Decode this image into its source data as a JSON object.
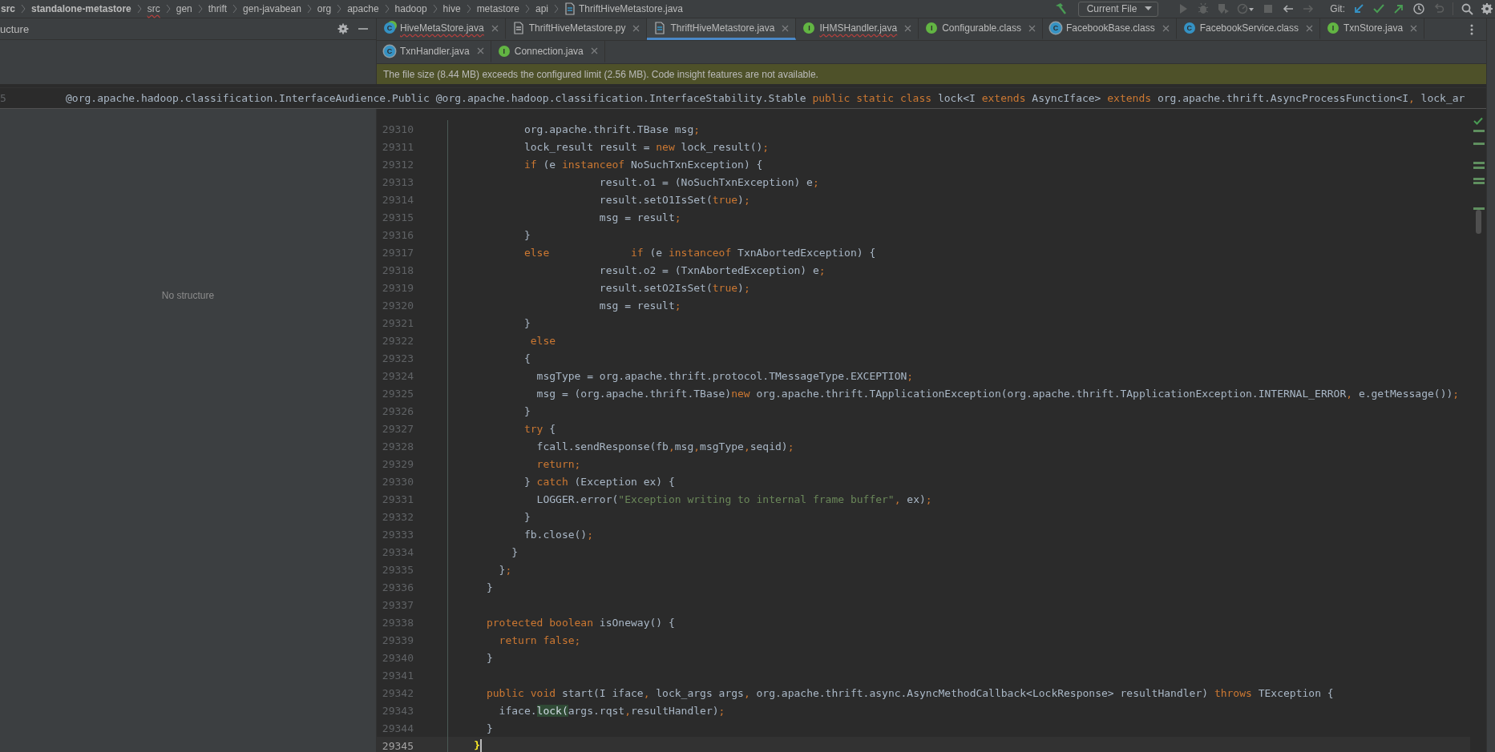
{
  "breadcrumbs": [
    {
      "label": "src",
      "bold": true,
      "error": false
    },
    {
      "label": "standalone-metastore",
      "bold": true,
      "error": false
    },
    {
      "label": "src",
      "bold": false,
      "error": true
    },
    {
      "label": "gen",
      "bold": false,
      "error": false
    },
    {
      "label": "thrift",
      "bold": false,
      "error": false
    },
    {
      "label": "gen-javabean",
      "bold": false,
      "error": false
    },
    {
      "label": "org",
      "bold": false,
      "error": false
    },
    {
      "label": "apache",
      "bold": false,
      "error": false
    },
    {
      "label": "hadoop",
      "bold": false,
      "error": false
    },
    {
      "label": "hive",
      "bold": false,
      "error": false
    },
    {
      "label": "metastore",
      "bold": false,
      "error": false
    },
    {
      "label": "api",
      "bold": false,
      "error": false
    },
    {
      "label": "ThriftHiveMetastore.java",
      "bold": false,
      "error": false,
      "kind": "file"
    }
  ],
  "toolbar": [
    {
      "kind": "hammer",
      "disabled": false
    },
    {
      "kind": "config",
      "label": "Current File"
    },
    {
      "kind": "run",
      "disabled": true
    },
    {
      "kind": "debug",
      "disabled": true
    },
    {
      "kind": "coverage",
      "disabled": true
    },
    {
      "kind": "profile",
      "disabled": true
    },
    {
      "kind": "stop",
      "disabled": true
    },
    {
      "kind": "back",
      "disabled": false
    },
    {
      "kind": "forward",
      "disabled": true
    },
    {
      "kind": "label",
      "label": "Git:"
    },
    {
      "kind": "update",
      "disabled": false
    },
    {
      "kind": "commit",
      "disabled": false
    },
    {
      "kind": "push",
      "disabled": false
    },
    {
      "kind": "history",
      "disabled": false
    },
    {
      "kind": "rollback",
      "disabled": true
    },
    {
      "kind": "search",
      "disabled": false
    },
    {
      "kind": "settings",
      "disabled": false
    }
  ],
  "structure_panel": {
    "title": "ucture",
    "empty_text": "No structure"
  },
  "tab_rows": [
    [
      {
        "label": "HiveMetaStore.java",
        "kind": "runnable-class",
        "badge": "C",
        "selected": false,
        "error": true
      },
      {
        "label": "ThriftHiveMetastore.py",
        "kind": "file",
        "selected": false,
        "error": false
      },
      {
        "label": "ThriftHiveMetastore.java",
        "kind": "java-file",
        "selected": true,
        "error": false
      },
      {
        "label": "IHMSHandler.java",
        "kind": "interface",
        "badge": "I",
        "selected": false,
        "error": true
      },
      {
        "label": "Configurable.class",
        "kind": "interface",
        "badge": "I",
        "selected": false,
        "error": false
      },
      {
        "label": "FacebookBase.class",
        "kind": "abstract-class",
        "badge": "C",
        "selected": false,
        "error": false
      },
      {
        "label": "FacebookService.class",
        "kind": "class",
        "badge": "C",
        "selected": false,
        "error": false
      },
      {
        "label": "TxnStore.java",
        "kind": "interface",
        "badge": "I",
        "selected": false,
        "error": false
      }
    ],
    [
      {
        "label": "TxnHandler.java",
        "kind": "abstract-class",
        "badge": "C",
        "selected": false,
        "error": false
      },
      {
        "label": "Connection.java",
        "kind": "interface",
        "badge": "I",
        "selected": false,
        "error": false
      }
    ]
  ],
  "banner": "The file size (8.44 MB) exceeds the configured limit (2.56 MB). Code insight features are not available.",
  "sticky_line": {
    "number": "5",
    "tokens": [
      {
        "kind": "plain",
        "text": "@org.apache.hadoop.classification.InterfaceAudience.Public @org.apache.hadoop.classification.InterfaceStability.Stable "
      },
      {
        "kind": "keyword",
        "text": "public static class"
      },
      {
        "kind": "plain",
        "text": " lock<I "
      },
      {
        "kind": "keyword",
        "text": "extends"
      },
      {
        "kind": "plain",
        "text": " AsyncIface> "
      },
      {
        "kind": "keyword",
        "text": "extends"
      },
      {
        "kind": "plain",
        "text": " org.apache.thrift.AsyncProcessFunction<I"
      },
      {
        "kind": "punct",
        "text": ","
      },
      {
        "kind": "plain",
        "text": " lock_ar"
      }
    ]
  },
  "code_lines": [
    {
      "number": "29310",
      "current": false,
      "tokens": [
        {
          "kind": "plain",
          "text": "            org.apache.thrift.TBase msg"
        },
        {
          "kind": "punct",
          "text": ";"
        }
      ]
    },
    {
      "number": "29311",
      "current": false,
      "tokens": [
        {
          "kind": "plain",
          "text": "            lock_result result = "
        },
        {
          "kind": "keyword",
          "text": "new"
        },
        {
          "kind": "plain",
          "text": " lock_result()"
        },
        {
          "kind": "punct",
          "text": ";"
        }
      ]
    },
    {
      "number": "29312",
      "current": false,
      "tokens": [
        {
          "kind": "keyword",
          "text": "            if"
        },
        {
          "kind": "plain",
          "text": " (e "
        },
        {
          "kind": "keyword",
          "text": "instanceof"
        },
        {
          "kind": "plain",
          "text": " NoSuchTxnException) {"
        }
      ]
    },
    {
      "number": "29313",
      "current": false,
      "tokens": [
        {
          "kind": "plain",
          "text": "                        result.o1 = (NoSuchTxnException) e"
        },
        {
          "kind": "punct",
          "text": ";"
        }
      ]
    },
    {
      "number": "29314",
      "current": false,
      "tokens": [
        {
          "kind": "plain",
          "text": "                        result.setO1IsSet("
        },
        {
          "kind": "keyword",
          "text": "true"
        },
        {
          "kind": "plain",
          "text": ")"
        },
        {
          "kind": "punct",
          "text": ";"
        }
      ]
    },
    {
      "number": "29315",
      "current": false,
      "tokens": [
        {
          "kind": "plain",
          "text": "                        msg = result"
        },
        {
          "kind": "punct",
          "text": ";"
        }
      ]
    },
    {
      "number": "29316",
      "current": false,
      "tokens": [
        {
          "kind": "plain",
          "text": "            }"
        }
      ]
    },
    {
      "number": "29317",
      "current": false,
      "tokens": [
        {
          "kind": "keyword",
          "text": "            else             if"
        },
        {
          "kind": "plain",
          "text": " (e "
        },
        {
          "kind": "keyword",
          "text": "instanceof"
        },
        {
          "kind": "plain",
          "text": " TxnAbortedException) {"
        }
      ]
    },
    {
      "number": "29318",
      "current": false,
      "tokens": [
        {
          "kind": "plain",
          "text": "                        result.o2 = (TxnAbortedException) e"
        },
        {
          "kind": "punct",
          "text": ";"
        }
      ]
    },
    {
      "number": "29319",
      "current": false,
      "tokens": [
        {
          "kind": "plain",
          "text": "                        result.setO2IsSet("
        },
        {
          "kind": "keyword",
          "text": "true"
        },
        {
          "kind": "plain",
          "text": ")"
        },
        {
          "kind": "punct",
          "text": ";"
        }
      ]
    },
    {
      "number": "29320",
      "current": false,
      "tokens": [
        {
          "kind": "plain",
          "text": "                        msg = result"
        },
        {
          "kind": "punct",
          "text": ";"
        }
      ]
    },
    {
      "number": "29321",
      "current": false,
      "tokens": [
        {
          "kind": "plain",
          "text": "            }"
        }
      ]
    },
    {
      "number": "29322",
      "current": false,
      "tokens": [
        {
          "kind": "keyword",
          "text": "             else"
        }
      ]
    },
    {
      "number": "29323",
      "current": false,
      "tokens": [
        {
          "kind": "plain",
          "text": "            {"
        }
      ]
    },
    {
      "number": "29324",
      "current": false,
      "tokens": [
        {
          "kind": "plain",
          "text": "              msgType = org.apache.thrift.protocol.TMessageType.EXCEPTION"
        },
        {
          "kind": "punct",
          "text": ";"
        }
      ]
    },
    {
      "number": "29325",
      "current": false,
      "tokens": [
        {
          "kind": "plain",
          "text": "              msg = (org.apache.thrift.TBase)"
        },
        {
          "kind": "keyword",
          "text": "new"
        },
        {
          "kind": "plain",
          "text": " org.apache.thrift.TApplicationException(org.apache.thrift.TApplicationException.INTERNAL_ERROR"
        },
        {
          "kind": "punct",
          "text": ","
        },
        {
          "kind": "plain",
          "text": " e.getMessage())"
        },
        {
          "kind": "punct",
          "text": ";"
        }
      ]
    },
    {
      "number": "29326",
      "current": false,
      "tokens": [
        {
          "kind": "plain",
          "text": "            }"
        }
      ]
    },
    {
      "number": "29327",
      "current": false,
      "tokens": [
        {
          "kind": "keyword",
          "text": "            try"
        },
        {
          "kind": "plain",
          "text": " {"
        }
      ]
    },
    {
      "number": "29328",
      "current": false,
      "tokens": [
        {
          "kind": "plain",
          "text": "              fcall.sendResponse(fb"
        },
        {
          "kind": "punct",
          "text": ","
        },
        {
          "kind": "plain",
          "text": "msg"
        },
        {
          "kind": "punct",
          "text": ","
        },
        {
          "kind": "plain",
          "text": "msgType"
        },
        {
          "kind": "punct",
          "text": ","
        },
        {
          "kind": "plain",
          "text": "seqid)"
        },
        {
          "kind": "punct",
          "text": ";"
        }
      ]
    },
    {
      "number": "29329",
      "current": false,
      "tokens": [
        {
          "kind": "keyword",
          "text": "              return"
        },
        {
          "kind": "punct",
          "text": ";"
        }
      ]
    },
    {
      "number": "29330",
      "current": false,
      "tokens": [
        {
          "kind": "plain",
          "text": "            } "
        },
        {
          "kind": "keyword",
          "text": "catch"
        },
        {
          "kind": "plain",
          "text": " (Exception ex) {"
        }
      ]
    },
    {
      "number": "29331",
      "current": false,
      "tokens": [
        {
          "kind": "plain",
          "text": "              LOGGER.error("
        },
        {
          "kind": "string",
          "text": "\"Exception writing to internal frame buffer\""
        },
        {
          "kind": "punct",
          "text": ","
        },
        {
          "kind": "plain",
          "text": " ex)"
        },
        {
          "kind": "punct",
          "text": ";"
        }
      ]
    },
    {
      "number": "29332",
      "current": false,
      "tokens": [
        {
          "kind": "plain",
          "text": "            }"
        }
      ]
    },
    {
      "number": "29333",
      "current": false,
      "tokens": [
        {
          "kind": "plain",
          "text": "            fb.close()"
        },
        {
          "kind": "punct",
          "text": ";"
        }
      ]
    },
    {
      "number": "29334",
      "current": false,
      "tokens": [
        {
          "kind": "plain",
          "text": "          }"
        }
      ]
    },
    {
      "number": "29335",
      "current": false,
      "tokens": [
        {
          "kind": "plain",
          "text": "        }"
        },
        {
          "kind": "punct",
          "text": ";"
        }
      ]
    },
    {
      "number": "29336",
      "current": false,
      "tokens": [
        {
          "kind": "plain",
          "text": "      }"
        }
      ]
    },
    {
      "number": "29337",
      "current": false
    },
    {
      "number": "29338",
      "current": false,
      "tokens": [
        {
          "kind": "keyword",
          "text": "      protected boolean"
        },
        {
          "kind": "plain",
          "text": " isOneway() {"
        }
      ]
    },
    {
      "number": "29339",
      "current": false,
      "tokens": [
        {
          "kind": "keyword",
          "text": "        return false"
        },
        {
          "kind": "punct",
          "text": ";"
        }
      ]
    },
    {
      "number": "29340",
      "current": false,
      "tokens": [
        {
          "kind": "plain",
          "text": "      }"
        }
      ]
    },
    {
      "number": "29341",
      "current": false
    },
    {
      "number": "29342",
      "current": false,
      "tokens": [
        {
          "kind": "keyword",
          "text": "      public void"
        },
        {
          "kind": "plain",
          "text": " start(I iface"
        },
        {
          "kind": "punct",
          "text": ","
        },
        {
          "kind": "plain",
          "text": " lock_args args"
        },
        {
          "kind": "punct",
          "text": ","
        },
        {
          "kind": "plain",
          "text": " org.apache.thrift.async.AsyncMethodCallback<LockResponse> resultHandler) "
        },
        {
          "kind": "keyword",
          "text": "throws"
        },
        {
          "kind": "plain",
          "text": " TException {"
        }
      ]
    },
    {
      "number": "29343",
      "current": false,
      "tokens": [
        {
          "kind": "plain",
          "text": "        iface."
        },
        {
          "kind": "match",
          "text": "lock("
        },
        {
          "kind": "plain",
          "text": "args.rqst"
        },
        {
          "kind": "punct",
          "text": ","
        },
        {
          "kind": "plain",
          "text": "resultHandler)"
        },
        {
          "kind": "punct",
          "text": ";"
        }
      ]
    },
    {
      "number": "29344",
      "current": false,
      "tokens": [
        {
          "kind": "plain",
          "text": "      }"
        }
      ]
    },
    {
      "number": "29345",
      "current": true,
      "tokens": [
        {
          "kind": "brace",
          "text": "    }"
        }
      ]
    }
  ]
}
